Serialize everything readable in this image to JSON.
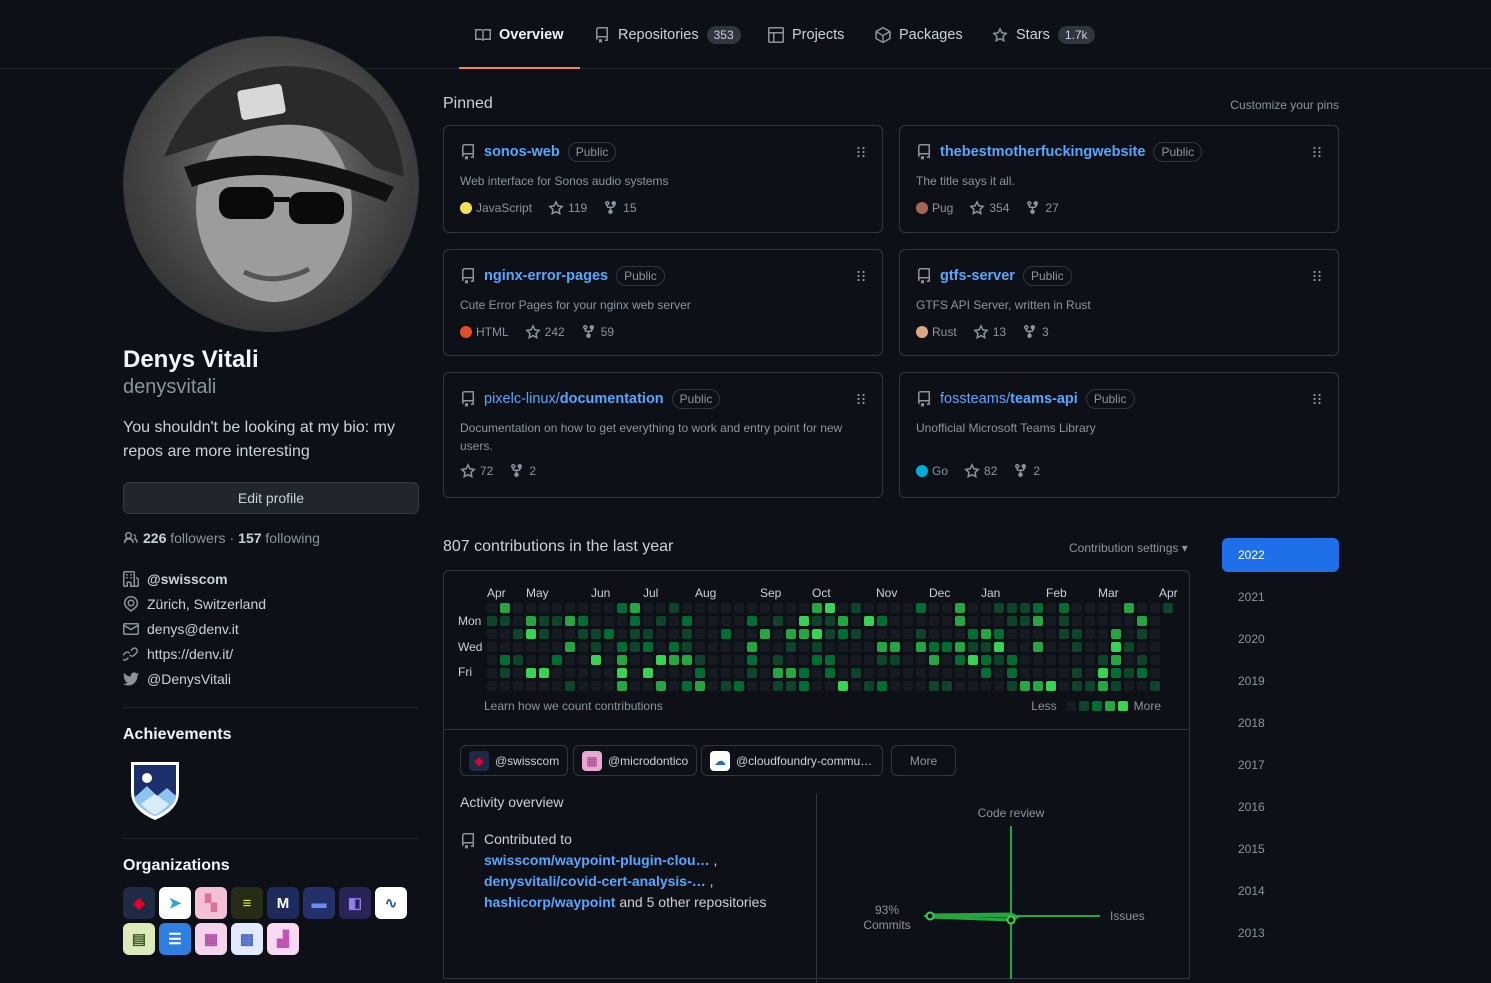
{
  "nav": {
    "tabs": [
      {
        "label": "Overview",
        "count": ""
      },
      {
        "label": "Repositories",
        "count": "353"
      },
      {
        "label": "Projects",
        "count": ""
      },
      {
        "label": "Packages",
        "count": ""
      },
      {
        "label": "Stars",
        "count": "1.7k"
      }
    ]
  },
  "profile": {
    "name": "Denys Vitali",
    "login": "denysvitali",
    "bio": "You shouldn't be looking at my bio: my repos are more interesting",
    "edit_label": "Edit profile",
    "followers": "226",
    "followers_label": "followers",
    "dot": "·",
    "following": "157",
    "following_label": "following",
    "company": "@swisscom",
    "location": "Zürich, Switzerland",
    "email": "denys@denv.it",
    "website": "https://denv.it/",
    "twitter": "@DenysVitali",
    "achievements_title": "Achievements",
    "organizations_title": "Organizations",
    "orgs": [
      {
        "name": "swisscom-logo",
        "bg": "#1f2b44",
        "glyph": "◆",
        "color": "#e4002b"
      },
      {
        "name": "telegram-logo",
        "bg": "#ffffff",
        "glyph": "➤",
        "color": "#2aa3e0"
      },
      {
        "name": "pink-pixel-logo",
        "bg": "#f3c1d6",
        "glyph": "▚",
        "color": "#d9719c"
      },
      {
        "name": "yellow-stack-logo",
        "bg": "#262c16",
        "glyph": "≡",
        "color": "#d6e83a"
      },
      {
        "name": "m-logo",
        "bg": "#1d2b5c",
        "glyph": "M",
        "color": "#ffffff"
      },
      {
        "name": "car-logo",
        "bg": "#25306b",
        "glyph": "▬",
        "color": "#6b8ef0"
      },
      {
        "name": "purple-card-logo",
        "bg": "#2a2356",
        "glyph": "◧",
        "color": "#8f7cf0"
      },
      {
        "name": "white-wave-logo",
        "bg": "#ffffff",
        "glyph": "∿",
        "color": "#27589c"
      },
      {
        "name": "green-book-logo",
        "bg": "#dce9b8",
        "glyph": "▤",
        "color": "#3e5a22"
      },
      {
        "name": "blue-doc-logo",
        "bg": "#2f7fe0",
        "glyph": "☰",
        "color": "#ffffff"
      },
      {
        "name": "pink-grid-logo",
        "bg": "#f4d3ec",
        "glyph": "▦",
        "color": "#b14ea8"
      },
      {
        "name": "blue-checker-logo",
        "bg": "#e3eaff",
        "glyph": "▩",
        "color": "#4d69c9"
      },
      {
        "name": "pink-invader-logo",
        "bg": "#f8d9f2",
        "glyph": "▟",
        "color": "#c154b6"
      }
    ]
  },
  "pinned": {
    "title": "Pinned",
    "customize": "Customize your pins",
    "repos": [
      {
        "owner": "",
        "name": "sonos-web",
        "vis": "Public",
        "desc": "Web interface for Sonos audio systems",
        "lang": "JavaScript",
        "lang_color": "#f1e05a",
        "stars": "119",
        "forks": "15"
      },
      {
        "owner": "",
        "name": "thebestmotherfuckingwebsite",
        "vis": "Public",
        "desc": "The title says it all.",
        "lang": "Pug",
        "lang_color": "#a86454",
        "stars": "354",
        "forks": "27"
      },
      {
        "owner": "",
        "name": "nginx-error-pages",
        "vis": "Public",
        "desc": "Cute Error Pages for your nginx web server",
        "lang": "HTML",
        "lang_color": "#e34c26",
        "stars": "242",
        "forks": "59"
      },
      {
        "owner": "",
        "name": "gtfs-server",
        "vis": "Public",
        "desc": "GTFS API Server, written in Rust",
        "lang": "Rust",
        "lang_color": "#dea584",
        "stars": "13",
        "forks": "3"
      },
      {
        "owner": "pixelc-linux/",
        "name": "documentation",
        "vis": "Public",
        "desc": "Documentation on how to get everything to work and entry point for new users.",
        "lang": "",
        "lang_color": "",
        "stars": "72",
        "forks": "2"
      },
      {
        "owner": "fossteams/",
        "name": "teams-api",
        "vis": "Public",
        "desc": "Unofficial Microsoft Teams Library",
        "lang": "Go",
        "lang_color": "#00add8",
        "stars": "82",
        "forks": "2"
      }
    ]
  },
  "contributions": {
    "title": "807 contributions in the last year",
    "settings": "Contribution settings",
    "months": [
      "Apr",
      "May",
      "Jun",
      "Jul",
      "Aug",
      "Sep",
      "Oct",
      "Nov",
      "Dec",
      "Jan",
      "Feb",
      "Mar",
      "Apr"
    ],
    "days": [
      "Mon",
      "Wed",
      "Fri"
    ],
    "learn": "Learn how we count contributions",
    "less": "Less",
    "more": "More",
    "levels": [
      "#161b22",
      "#0e4429",
      "#006d32",
      "#26a641",
      "#39d353"
    ]
  },
  "activity": {
    "orgs": [
      {
        "label": "@swisscom",
        "color": "#1f2b44"
      },
      {
        "label": "@microdontico",
        "color": "#e8a8d0"
      },
      {
        "label": "@cloudfoundry-commu…",
        "color": "#ffffff"
      }
    ],
    "more": "More",
    "title": "Activity overview",
    "contributed_to": "Contributed to",
    "repo1": "swisscom/waypoint-plugin-clou…",
    "repo2": "denysvitali/covid-cert-analysis-…",
    "repo3": "hashicorp/waypoint",
    "sep": ",",
    "tail": "and 5 other repositories",
    "code_review": "Code review",
    "issues": "Issues",
    "commits_pct": "93%",
    "commits": "Commits",
    "commits_value": 93,
    "issues_value": 7
  },
  "years": [
    "2022",
    "2021",
    "2020",
    "2019",
    "2018",
    "2017",
    "2016",
    "2015",
    "2014",
    "2013"
  ]
}
